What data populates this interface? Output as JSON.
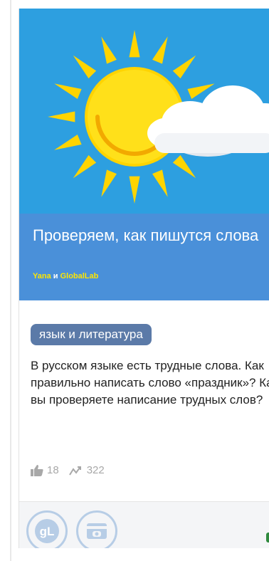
{
  "card": {
    "title": "Проверяем, как пишутся слова",
    "authors": {
      "first": "Yana",
      "connector": "и",
      "second": "GlobalLab"
    },
    "tag": "язык и литература",
    "description": "В русском языке есть трудные слова. Как правильно написать слово «праздник»? Как вы проверяете написание трудных слов?",
    "stats": {
      "likes": "18",
      "views": "322"
    },
    "footer": {
      "buttons": [
        {
          "icon": "globallab-logo-icon",
          "label": "gL"
        },
        {
          "icon": "card-icon"
        }
      ]
    }
  },
  "colors": {
    "hero_sky": "#2d9fe0",
    "title_band": "#4a90d9",
    "author_link": "#ffe600",
    "tag_bg": "#5b7aa8",
    "sun": "#ffd700"
  }
}
